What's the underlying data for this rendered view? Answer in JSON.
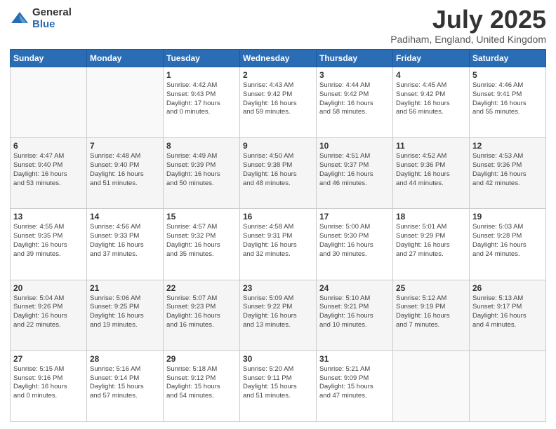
{
  "header": {
    "logo_general": "General",
    "logo_blue": "Blue",
    "month_title": "July 2025",
    "location": "Padiham, England, United Kingdom"
  },
  "weekdays": [
    "Sunday",
    "Monday",
    "Tuesday",
    "Wednesday",
    "Thursday",
    "Friday",
    "Saturday"
  ],
  "weeks": [
    [
      {
        "day": "",
        "info": ""
      },
      {
        "day": "",
        "info": ""
      },
      {
        "day": "1",
        "info": "Sunrise: 4:42 AM\nSunset: 9:43 PM\nDaylight: 17 hours\nand 0 minutes."
      },
      {
        "day": "2",
        "info": "Sunrise: 4:43 AM\nSunset: 9:42 PM\nDaylight: 16 hours\nand 59 minutes."
      },
      {
        "day": "3",
        "info": "Sunrise: 4:44 AM\nSunset: 9:42 PM\nDaylight: 16 hours\nand 58 minutes."
      },
      {
        "day": "4",
        "info": "Sunrise: 4:45 AM\nSunset: 9:42 PM\nDaylight: 16 hours\nand 56 minutes."
      },
      {
        "day": "5",
        "info": "Sunrise: 4:46 AM\nSunset: 9:41 PM\nDaylight: 16 hours\nand 55 minutes."
      }
    ],
    [
      {
        "day": "6",
        "info": "Sunrise: 4:47 AM\nSunset: 9:40 PM\nDaylight: 16 hours\nand 53 minutes."
      },
      {
        "day": "7",
        "info": "Sunrise: 4:48 AM\nSunset: 9:40 PM\nDaylight: 16 hours\nand 51 minutes."
      },
      {
        "day": "8",
        "info": "Sunrise: 4:49 AM\nSunset: 9:39 PM\nDaylight: 16 hours\nand 50 minutes."
      },
      {
        "day": "9",
        "info": "Sunrise: 4:50 AM\nSunset: 9:38 PM\nDaylight: 16 hours\nand 48 minutes."
      },
      {
        "day": "10",
        "info": "Sunrise: 4:51 AM\nSunset: 9:37 PM\nDaylight: 16 hours\nand 46 minutes."
      },
      {
        "day": "11",
        "info": "Sunrise: 4:52 AM\nSunset: 9:36 PM\nDaylight: 16 hours\nand 44 minutes."
      },
      {
        "day": "12",
        "info": "Sunrise: 4:53 AM\nSunset: 9:36 PM\nDaylight: 16 hours\nand 42 minutes."
      }
    ],
    [
      {
        "day": "13",
        "info": "Sunrise: 4:55 AM\nSunset: 9:35 PM\nDaylight: 16 hours\nand 39 minutes."
      },
      {
        "day": "14",
        "info": "Sunrise: 4:56 AM\nSunset: 9:33 PM\nDaylight: 16 hours\nand 37 minutes."
      },
      {
        "day": "15",
        "info": "Sunrise: 4:57 AM\nSunset: 9:32 PM\nDaylight: 16 hours\nand 35 minutes."
      },
      {
        "day": "16",
        "info": "Sunrise: 4:58 AM\nSunset: 9:31 PM\nDaylight: 16 hours\nand 32 minutes."
      },
      {
        "day": "17",
        "info": "Sunrise: 5:00 AM\nSunset: 9:30 PM\nDaylight: 16 hours\nand 30 minutes."
      },
      {
        "day": "18",
        "info": "Sunrise: 5:01 AM\nSunset: 9:29 PM\nDaylight: 16 hours\nand 27 minutes."
      },
      {
        "day": "19",
        "info": "Sunrise: 5:03 AM\nSunset: 9:28 PM\nDaylight: 16 hours\nand 24 minutes."
      }
    ],
    [
      {
        "day": "20",
        "info": "Sunrise: 5:04 AM\nSunset: 9:26 PM\nDaylight: 16 hours\nand 22 minutes."
      },
      {
        "day": "21",
        "info": "Sunrise: 5:06 AM\nSunset: 9:25 PM\nDaylight: 16 hours\nand 19 minutes."
      },
      {
        "day": "22",
        "info": "Sunrise: 5:07 AM\nSunset: 9:23 PM\nDaylight: 16 hours\nand 16 minutes."
      },
      {
        "day": "23",
        "info": "Sunrise: 5:09 AM\nSunset: 9:22 PM\nDaylight: 16 hours\nand 13 minutes."
      },
      {
        "day": "24",
        "info": "Sunrise: 5:10 AM\nSunset: 9:21 PM\nDaylight: 16 hours\nand 10 minutes."
      },
      {
        "day": "25",
        "info": "Sunrise: 5:12 AM\nSunset: 9:19 PM\nDaylight: 16 hours\nand 7 minutes."
      },
      {
        "day": "26",
        "info": "Sunrise: 5:13 AM\nSunset: 9:17 PM\nDaylight: 16 hours\nand 4 minutes."
      }
    ],
    [
      {
        "day": "27",
        "info": "Sunrise: 5:15 AM\nSunset: 9:16 PM\nDaylight: 16 hours\nand 0 minutes."
      },
      {
        "day": "28",
        "info": "Sunrise: 5:16 AM\nSunset: 9:14 PM\nDaylight: 15 hours\nand 57 minutes."
      },
      {
        "day": "29",
        "info": "Sunrise: 5:18 AM\nSunset: 9:12 PM\nDaylight: 15 hours\nand 54 minutes."
      },
      {
        "day": "30",
        "info": "Sunrise: 5:20 AM\nSunset: 9:11 PM\nDaylight: 15 hours\nand 51 minutes."
      },
      {
        "day": "31",
        "info": "Sunrise: 5:21 AM\nSunset: 9:09 PM\nDaylight: 15 hours\nand 47 minutes."
      },
      {
        "day": "",
        "info": ""
      },
      {
        "day": "",
        "info": ""
      }
    ]
  ]
}
